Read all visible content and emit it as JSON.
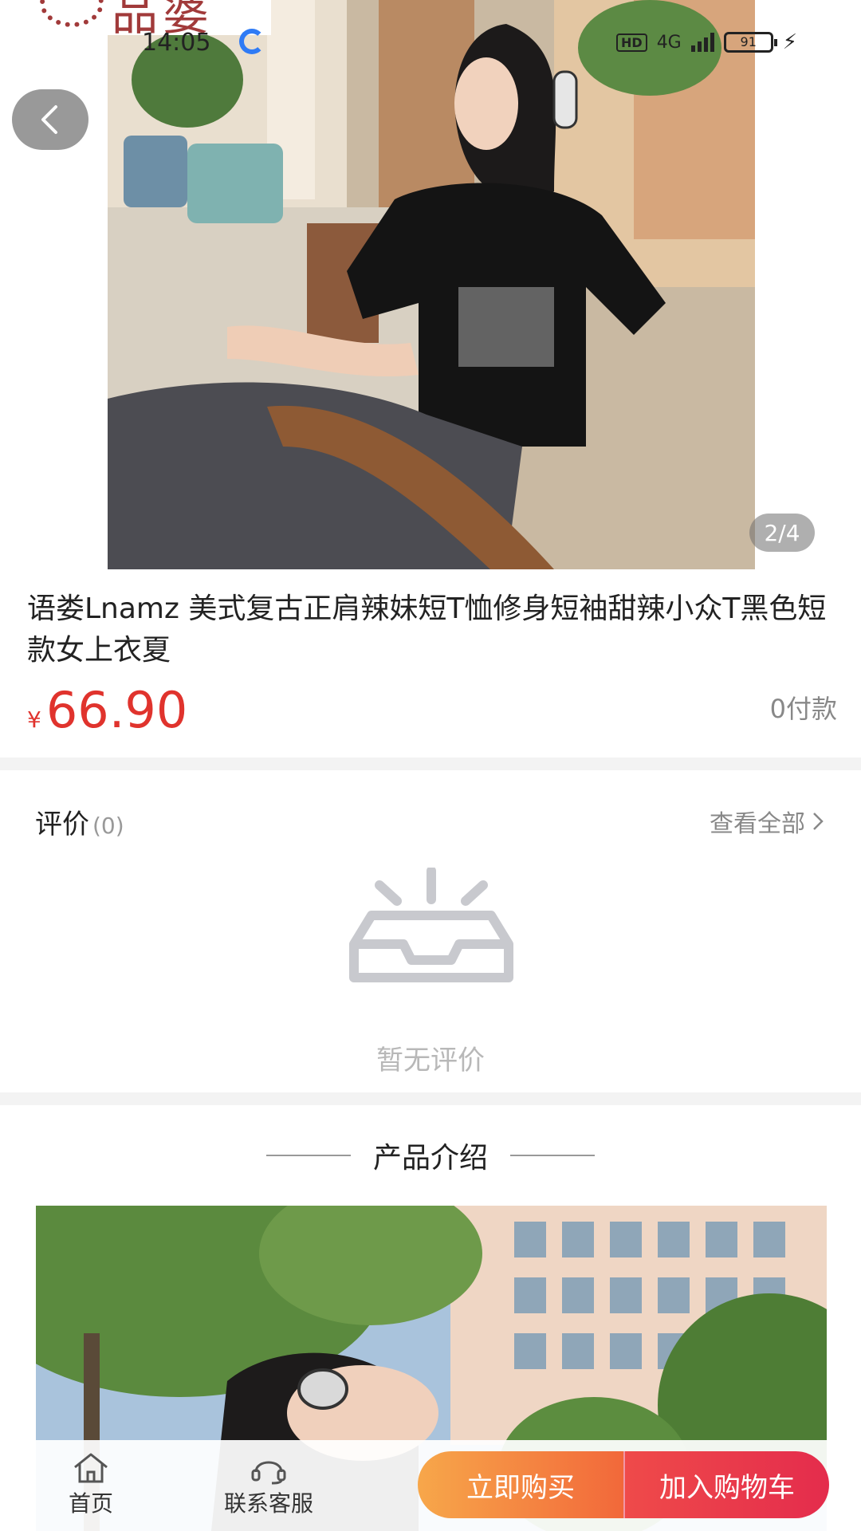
{
  "statusbar": {
    "time": "14:05",
    "hd": "HD",
    "network": "4G",
    "battery": "91"
  },
  "logo": {
    "text": "品婆"
  },
  "gallery": {
    "pager": "2/4"
  },
  "product": {
    "title": "语娄Lnamz 美式复古正肩辣妹短T恤修身短袖甜辣小众T黑色短款女上衣夏",
    "currency": "¥",
    "price": "66.90",
    "sold": "0付款"
  },
  "reviews": {
    "title": "评价",
    "count": "(0)",
    "view_all": "查看全部",
    "empty_text": "暂无评价"
  },
  "intro": {
    "title": "产品介绍"
  },
  "bottom_bar": {
    "home_label": "首页",
    "service_label": "联系客服",
    "buy_label": "立即购买",
    "cart_label": "加入购物车"
  },
  "colors": {
    "price": "#e0332d",
    "buy_gradient_start": "#f7a74a",
    "buy_gradient_end": "#f2683a",
    "cart_gradient_start": "#ef4a4a",
    "cart_gradient_end": "#e42c4c"
  }
}
